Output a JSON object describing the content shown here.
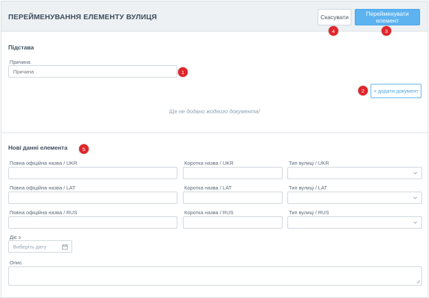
{
  "header": {
    "title": "ПЕРЕЙМЕНУВАННЯ ЕЛЕМЕНТУ ВУЛИЦЯ",
    "cancel_label": "Скасувати",
    "rename_label": "Перейменувати елемент"
  },
  "basis": {
    "title": "Підстава",
    "reason_label": "Причина",
    "reason_placeholder": "Причина",
    "add_doc_label": "+ додати документ",
    "empty_message": "Ще не додано жодного документа!"
  },
  "new_data": {
    "title": "Нові данні елемента",
    "rows": [
      {
        "full_label": "Повна офіційна назва / UKR",
        "short_label": "Коротка назва / UKR",
        "type_label": "Тип вулиці / UKR"
      },
      {
        "full_label": "Повна офіційна назва / LAT",
        "short_label": "Коротка назва / LAT",
        "type_label": "Тип вулиці / LAT"
      },
      {
        "full_label": "Повна офіційна назва / RUS",
        "short_label": "Коротка назва / RUS",
        "type_label": "Тип вулиці / RUS"
      }
    ],
    "valid_from_label": "Діє з",
    "date_placeholder": "Виберіть дату",
    "description_label": "Опис"
  },
  "markers": [
    "1",
    "2",
    "3",
    "4",
    "5"
  ],
  "colors": {
    "primary": "#5cb3f0",
    "marker": "#e0262b",
    "header_bg": "#eef1f4"
  }
}
